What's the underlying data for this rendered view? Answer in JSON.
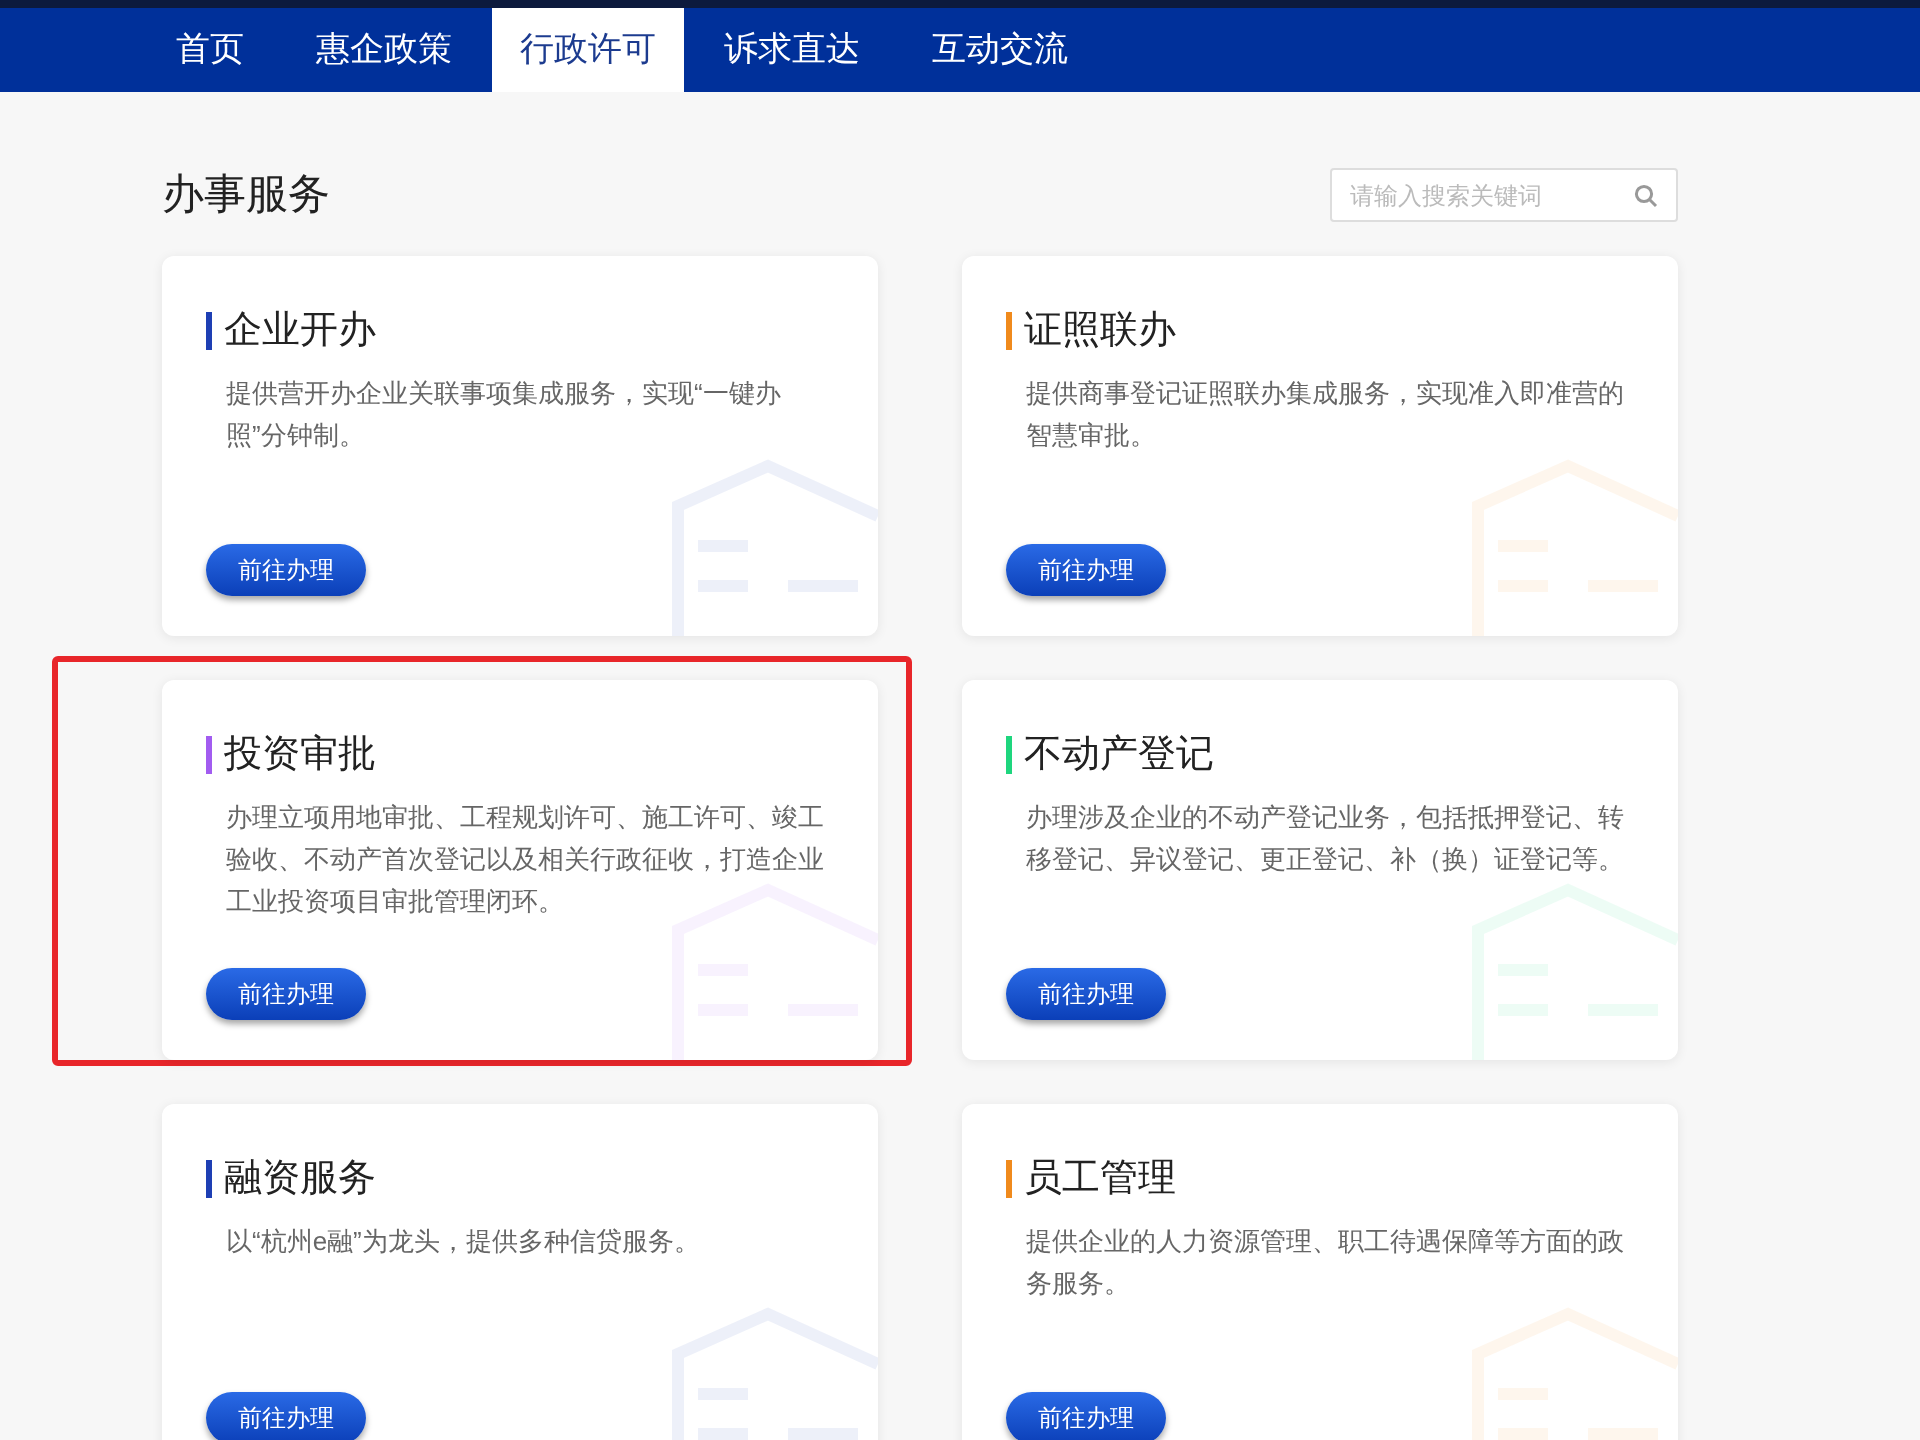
{
  "nav": [
    {
      "label": "首页",
      "selected": false
    },
    {
      "label": "惠企政策",
      "selected": false
    },
    {
      "label": "行政许可",
      "selected": true
    },
    {
      "label": "诉求直达",
      "selected": false
    },
    {
      "label": "互动交流",
      "selected": false
    }
  ],
  "section_title": "办事服务",
  "search": {
    "placeholder": "请输入搜索关键词"
  },
  "cards": [
    {
      "title": "企业开办",
      "color": "#1e3fb4",
      "description": "提供营开办企业关联事项集成服务，实现“一键办照”分钟制。",
      "button": "前往办理",
      "highlighted": false
    },
    {
      "title": "证照联办",
      "color": "#f08a1c",
      "description": "提供商事登记证照联办集成服务，实现准入即准营的智慧审批。",
      "button": "前往办理",
      "highlighted": false
    },
    {
      "title": "投资审批",
      "color": "#a25cf0",
      "description": "办理立项用地审批、工程规划许可、施工许可、竣工验收、不动产首次登记以及相关行政征收，打造企业工业投资项目审批管理闭环。",
      "button": "前往办理",
      "highlighted": true
    },
    {
      "title": "不动产登记",
      "color": "#1ed67e",
      "description": "办理涉及企业的不动产登记业务，包括抵押登记、转移登记、异议登记、更正登记、补（换）证登记等。",
      "button": "前往办理",
      "highlighted": false
    },
    {
      "title": "融资服务",
      "color": "#1e3fb4",
      "description": "以“杭州e融”为龙头，提供多种信贷服务。",
      "button": "前往办理",
      "highlighted": false
    },
    {
      "title": "员工管理",
      "color": "#f08a1c",
      "description": "提供企业的人力资源管理、职工待遇保障等方面的政务服务。",
      "button": "前往办理",
      "highlighted": false
    }
  ]
}
